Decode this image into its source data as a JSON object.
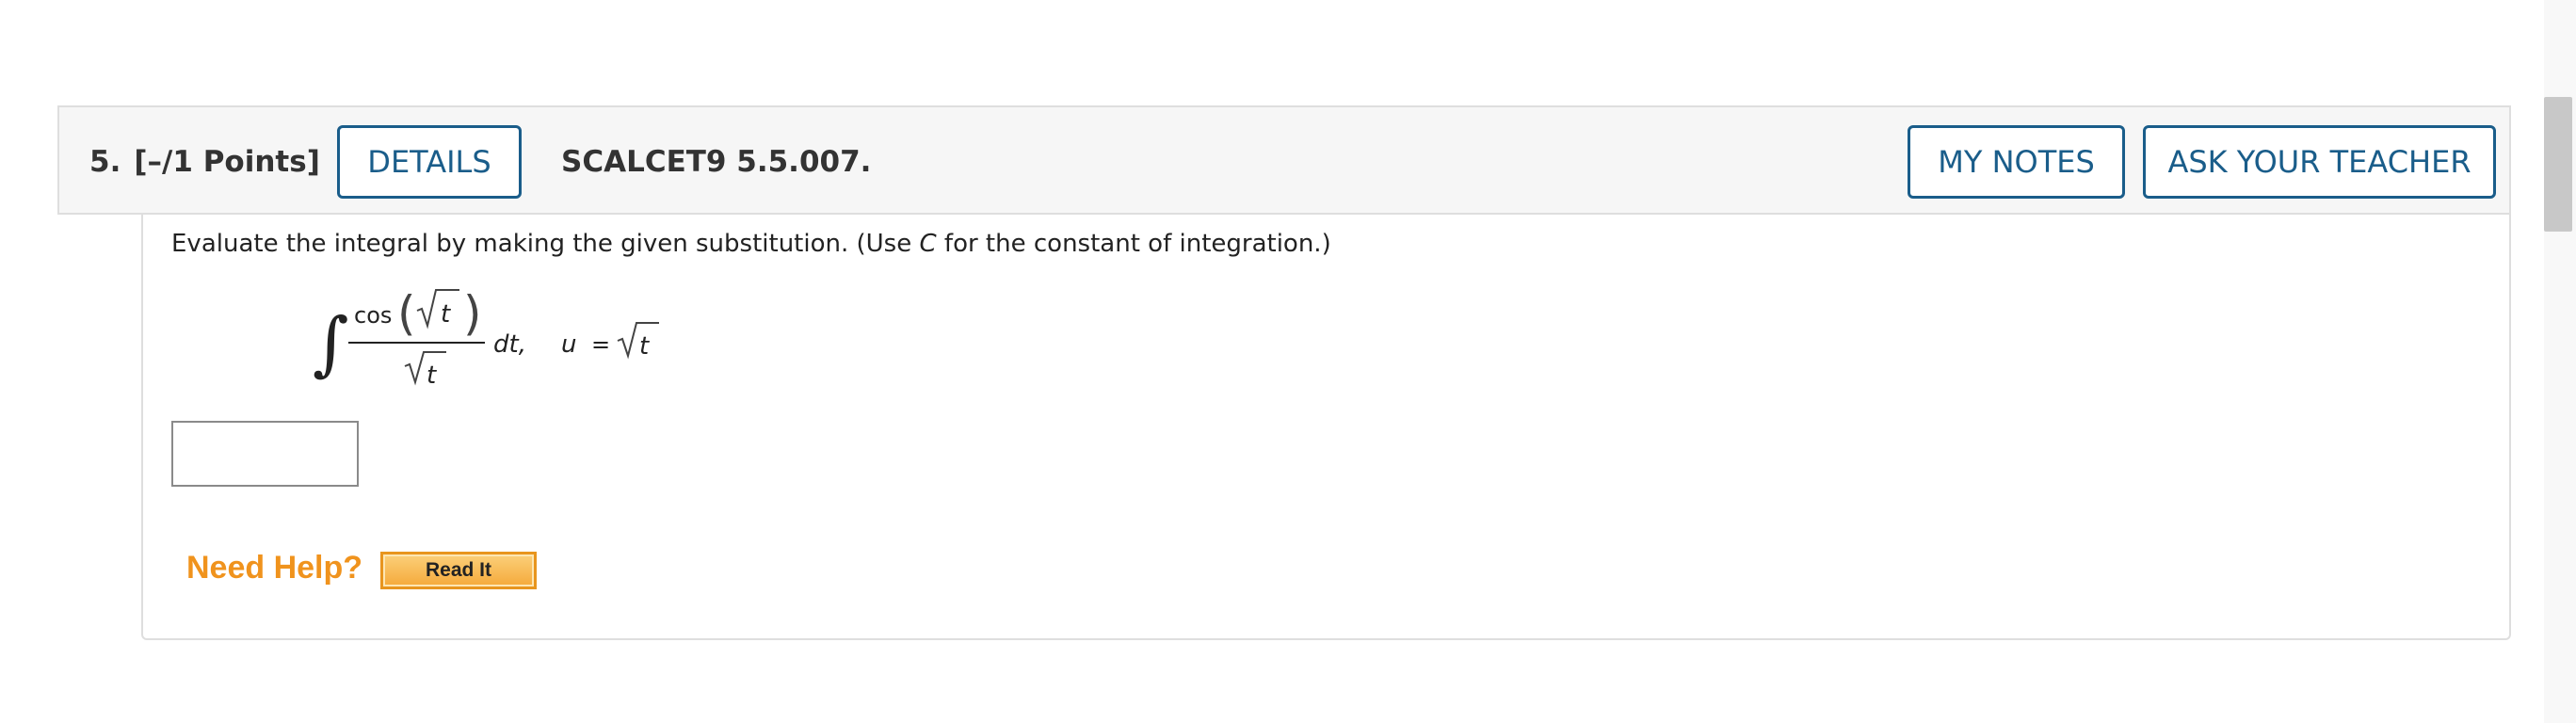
{
  "question": {
    "number": "5.",
    "points": "[–/1 Points]",
    "details_label": "DETAILS",
    "code": "SCALCET9 5.5.007.",
    "my_notes_label": "MY NOTES",
    "ask_teacher_label": "ASK YOUR TEACHER"
  },
  "body": {
    "instructions_pre": "Evaluate the integral by making the given substitution. (Use ",
    "instructions_var": "C",
    "instructions_post": " for the constant of integration.)",
    "math": {
      "integral_sign": "∫",
      "numerator_fn": "cos",
      "radicand": "t",
      "differential": "dt,",
      "sub_var": "u",
      "equals": "="
    },
    "answer_value": "",
    "need_help_label": "Need Help?",
    "read_it_label": "Read It"
  },
  "colors": {
    "accent": "#1a5d8a",
    "need_help": "#f0931d",
    "header_bg": "#f6f6f6"
  }
}
